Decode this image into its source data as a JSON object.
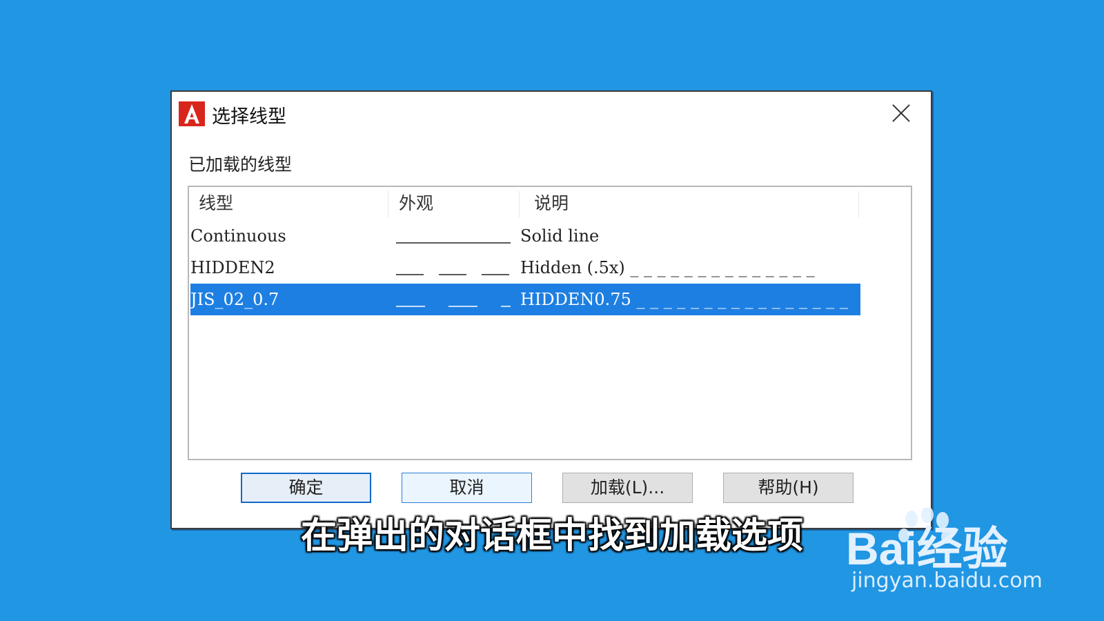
{
  "dialog": {
    "title": "选择线型",
    "group_label": "已加载的线型",
    "columns": [
      "线型",
      "外观",
      "说明"
    ],
    "rows": [
      {
        "name": "Continuous",
        "appearance": "solid",
        "description": "Solid line",
        "selected": false
      },
      {
        "name": "HIDDEN2",
        "appearance": "dashed-short",
        "description": "Hidden (.5x) _ _ _ _ _ _ _ _ _ _ _ _ _ _",
        "selected": false
      },
      {
        "name": "JIS_02_0.7",
        "appearance": "dashed-long",
        "description": "HIDDEN0.75 _ _ _ _ _ _ _ _ _ _ _ _ _ _ _ _",
        "selected": true
      }
    ],
    "buttons": {
      "ok": "确定",
      "cancel": "取消",
      "load": "加载(L)...",
      "help": "帮助(H)"
    }
  },
  "caption": "在弹出的对话框中找到加载选项",
  "watermark": {
    "brand": "Bai经验",
    "url": "jingyan.baidu.com"
  },
  "colors": {
    "background": "#2196e3",
    "selection": "#1e7fe2",
    "app_icon": "#d9261c"
  },
  "icons": {
    "app": "autocad-logo-icon",
    "close": "close-icon"
  }
}
